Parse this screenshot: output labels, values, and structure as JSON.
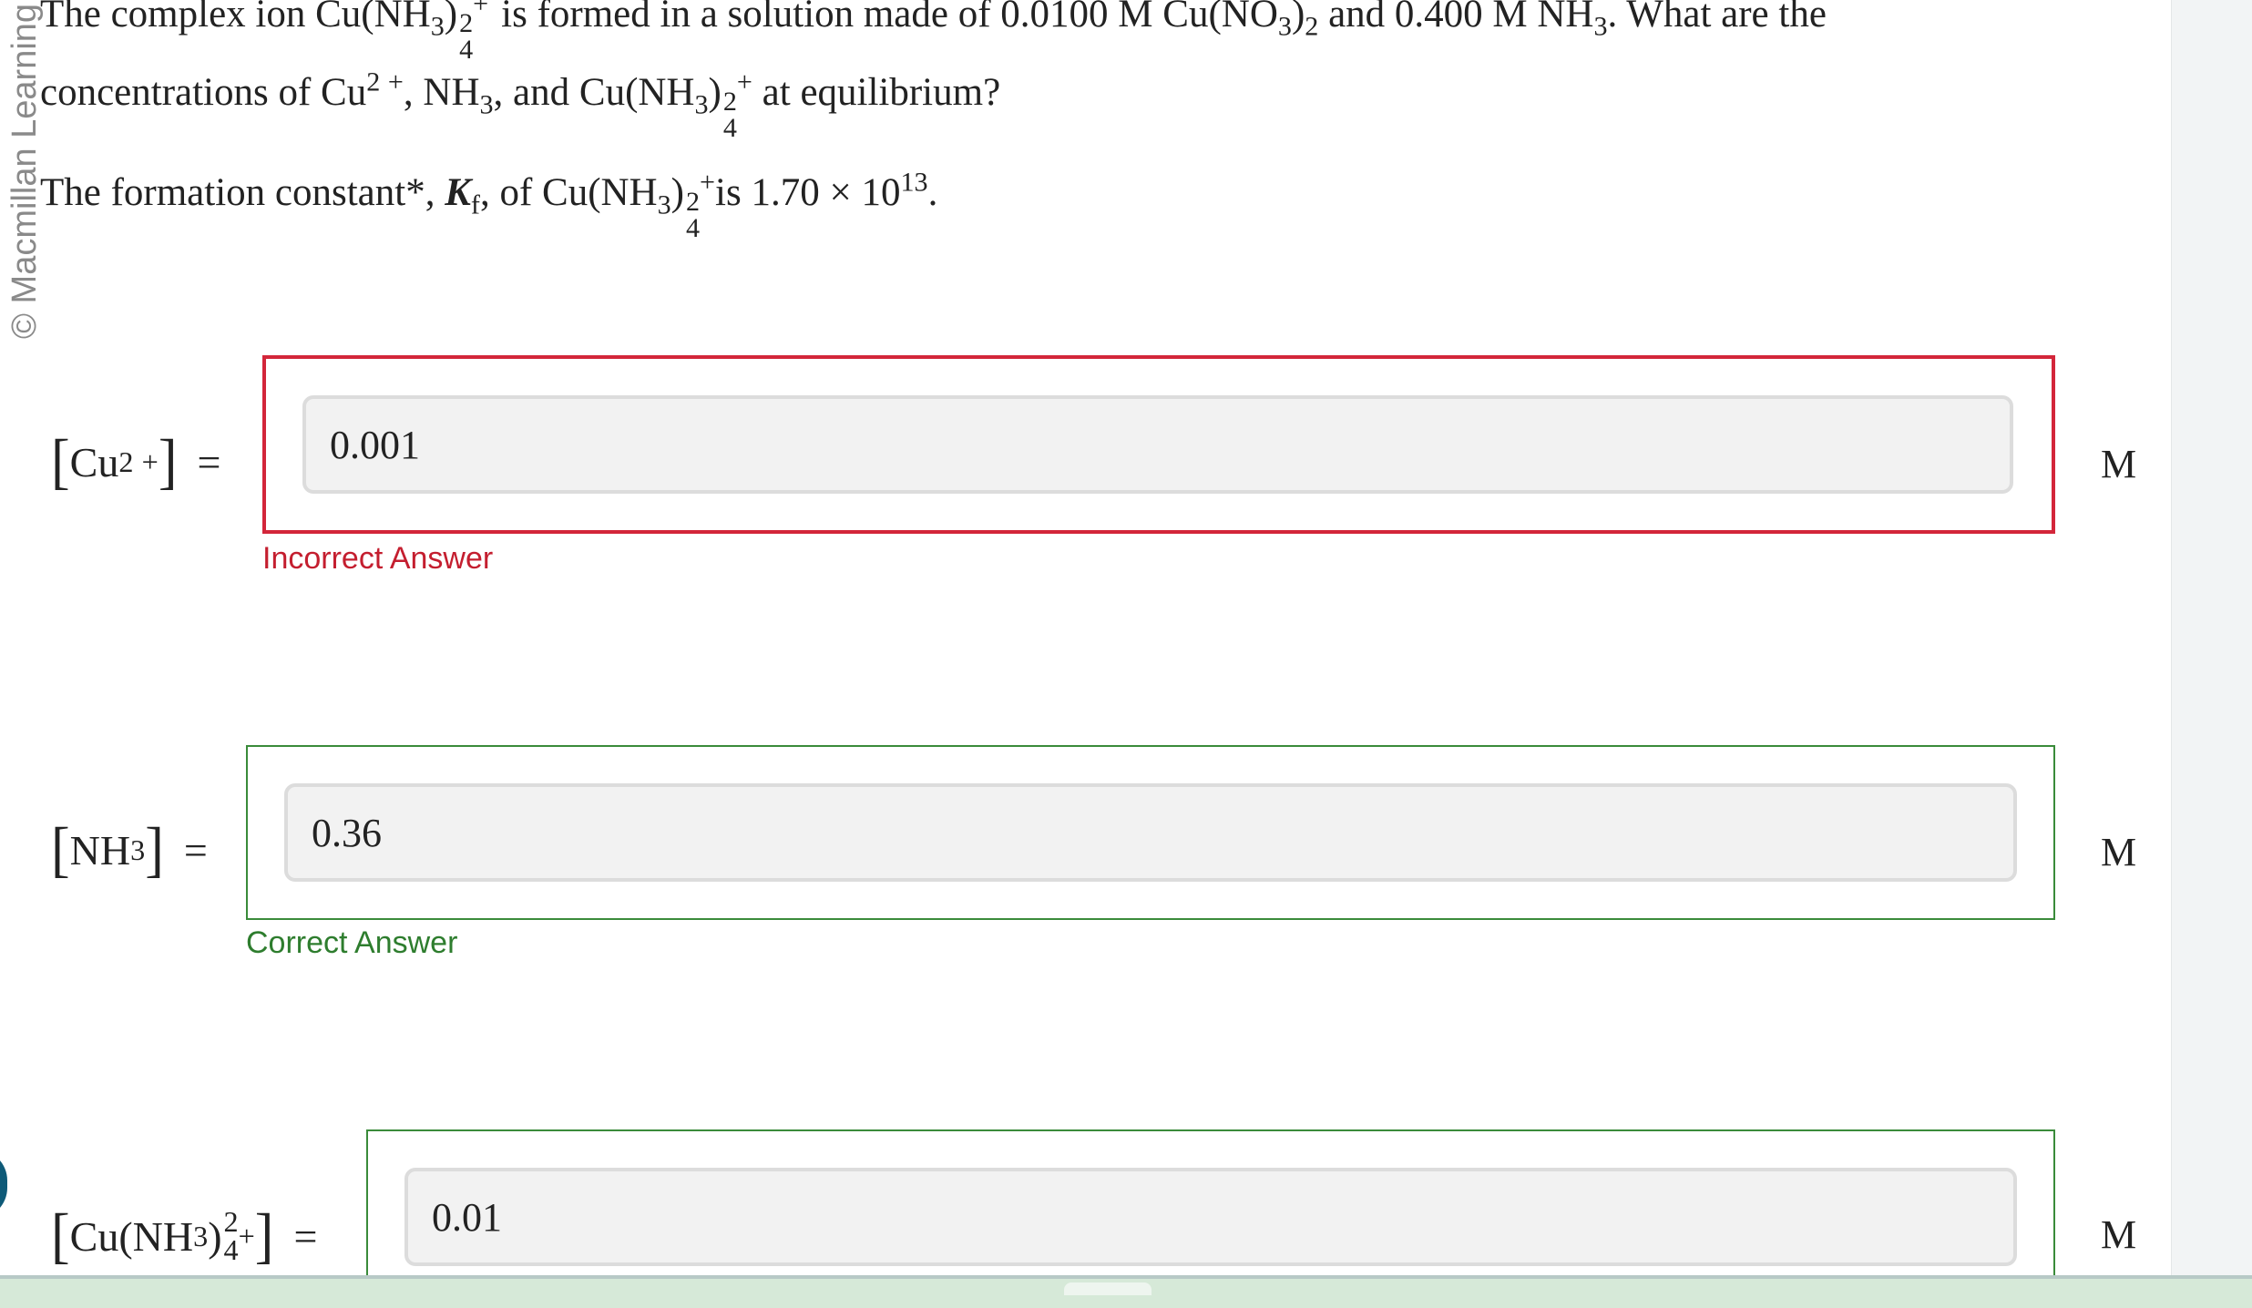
{
  "copyright": "© Macmillan Learning",
  "question": {
    "p1_a": "The complex ion Cu(NH",
    "p1_b": "is formed in a solution made of 0.0100 M Cu(NO",
    "p1_c": "and 0.400 M NH",
    "p1_d": ". What are the",
    "p2_a": "concentrations of Cu",
    "p2_b": ", NH",
    "p2_c": ", and Cu(NH",
    "p2_d": "at equilibrium?",
    "kf_a": "The formation constant*, ",
    "kf_K": "K",
    "kf_sub": "f",
    "kf_b": ", of Cu(NH",
    "kf_c": "is 1.70 × 10",
    "kf_exp": "13",
    "kf_end": ".",
    "sub3": "3",
    "sub4": "4",
    "sub2": "2",
    "sup2": "2",
    "plus": "+",
    "close_paren": ")"
  },
  "answers": [
    {
      "label_main": "Cu",
      "value": "0.001",
      "unit": "M",
      "feedback": "Incorrect Answer",
      "status": "incorrect",
      "status_color": "#d3263a"
    },
    {
      "label_main": "NH",
      "value": "0.36",
      "unit": "M",
      "feedback": "Correct Answer",
      "status": "correct",
      "status_color": "#3a8b3a"
    },
    {
      "label_main": "Cu(NH",
      "value": "0.01",
      "unit": "M",
      "feedback": "",
      "status": "correct",
      "status_color": "#3a8b3a"
    }
  ],
  "equals": "="
}
